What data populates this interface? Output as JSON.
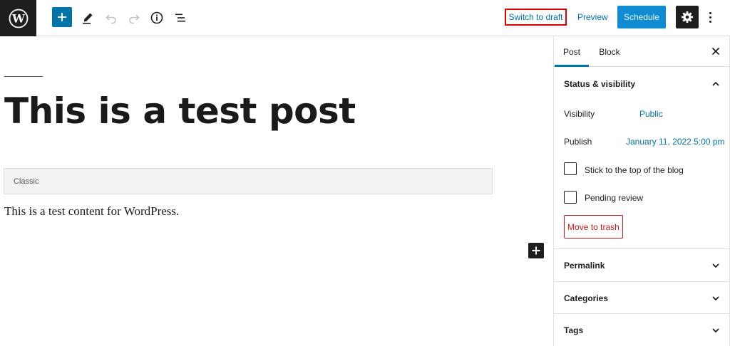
{
  "toolbar": {
    "logo_icon": "wordpress-icon",
    "inserter_icon": "plus-icon",
    "tools_icon": "pencil-icon",
    "undo_icon": "undo-icon",
    "redo_icon": "redo-icon",
    "details_icon": "info-icon",
    "outline_icon": "list-view-icon",
    "switch_to_draft_label": "Switch to draft",
    "preview_label": "Preview",
    "schedule_label": "Schedule",
    "settings_icon": "gear-icon",
    "more_icon": "vertical-ellipsis-icon",
    "accent_color": "#0073aa",
    "highlight_color": "#e00000"
  },
  "editor": {
    "title": "This is a test post",
    "classic_block_label": "Classic",
    "content": "This is a test content for WordPress.",
    "inserter_icon": "plus-icon"
  },
  "sidebar": {
    "tabs": [
      {
        "label": "Post",
        "active": true
      },
      {
        "label": "Block",
        "active": false
      }
    ],
    "close_icon": "close-icon",
    "status_panel": {
      "title": "Status & visibility",
      "expanded": true,
      "visibility_label": "Visibility",
      "visibility_value": "Public",
      "publish_label": "Publish",
      "publish_value": "January 11, 2022 5:00 pm",
      "sticky_label": "Stick to the top of the blog",
      "sticky_checked": false,
      "pending_label": "Pending review",
      "pending_checked": false,
      "trash_label": "Move to trash",
      "trash_color": "#cc1818"
    },
    "panels": [
      {
        "title": "Permalink",
        "expanded": false
      },
      {
        "title": "Categories",
        "expanded": false
      },
      {
        "title": "Tags",
        "expanded": false
      }
    ]
  }
}
